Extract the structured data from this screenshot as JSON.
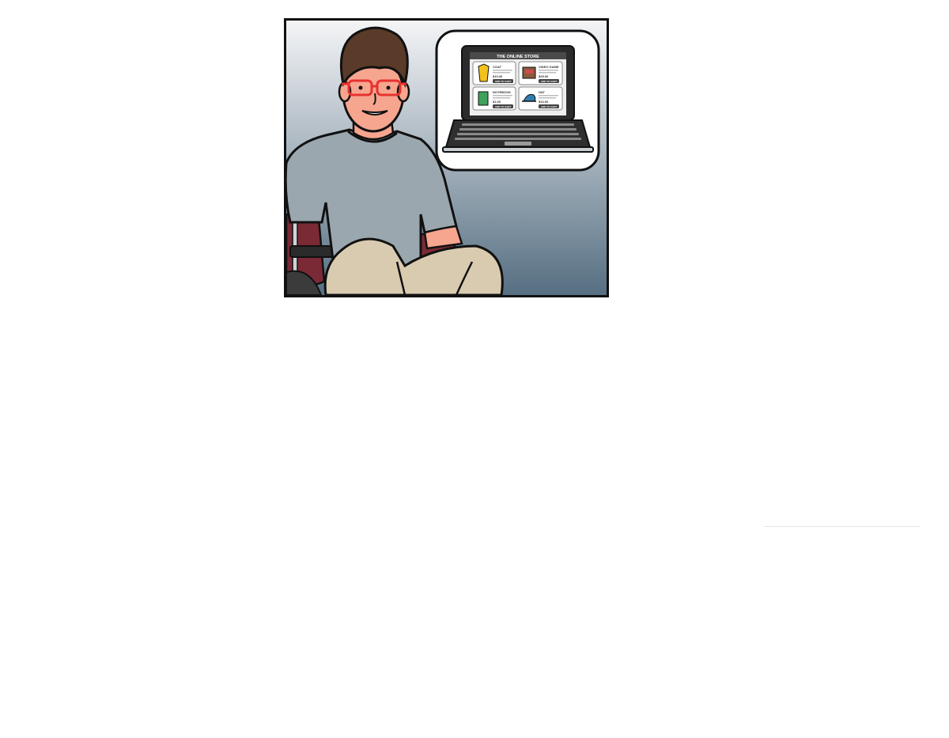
{
  "scene": {
    "store": {
      "title": "THE ONLINE STORE",
      "products": [
        {
          "name": "COAT",
          "price": "$10.00",
          "button": "ADD TO CART",
          "icon": "coat-icon"
        },
        {
          "name": "VIDEO GAME",
          "price": "$25.00",
          "button": "ADD TO CART",
          "icon": "video-game-icon"
        },
        {
          "name": "NOTEBOOK",
          "price": "$1.00",
          "button": "ADD TO CART",
          "icon": "notebook-icon"
        },
        {
          "name": "HAT",
          "price": "$10.00",
          "button": "ADD TO CART",
          "icon": "hat-icon"
        }
      ]
    }
  },
  "colors": {
    "background_top": "#f4f5f7",
    "background_bottom": "#566f82",
    "shirt": "#9aa7ae",
    "pants": "#d8cbb0",
    "hair": "#5a3a28",
    "skin": "#f6a58f",
    "glasses": "#e8322f",
    "wheelchair_seat": "#7a2a35"
  }
}
